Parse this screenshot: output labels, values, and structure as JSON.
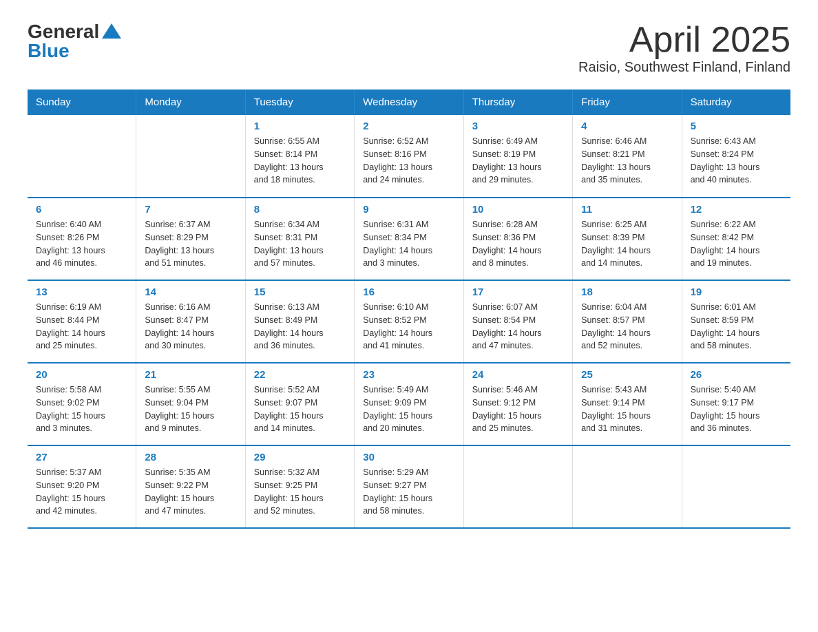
{
  "header": {
    "logo_general": "General",
    "logo_blue": "Blue",
    "month_title": "April 2025",
    "location": "Raisio, Southwest Finland, Finland"
  },
  "days_of_week": [
    "Sunday",
    "Monday",
    "Tuesday",
    "Wednesday",
    "Thursday",
    "Friday",
    "Saturday"
  ],
  "weeks": [
    [
      {
        "day": "",
        "info": ""
      },
      {
        "day": "",
        "info": ""
      },
      {
        "day": "1",
        "info": "Sunrise: 6:55 AM\nSunset: 8:14 PM\nDaylight: 13 hours\nand 18 minutes."
      },
      {
        "day": "2",
        "info": "Sunrise: 6:52 AM\nSunset: 8:16 PM\nDaylight: 13 hours\nand 24 minutes."
      },
      {
        "day": "3",
        "info": "Sunrise: 6:49 AM\nSunset: 8:19 PM\nDaylight: 13 hours\nand 29 minutes."
      },
      {
        "day": "4",
        "info": "Sunrise: 6:46 AM\nSunset: 8:21 PM\nDaylight: 13 hours\nand 35 minutes."
      },
      {
        "day": "5",
        "info": "Sunrise: 6:43 AM\nSunset: 8:24 PM\nDaylight: 13 hours\nand 40 minutes."
      }
    ],
    [
      {
        "day": "6",
        "info": "Sunrise: 6:40 AM\nSunset: 8:26 PM\nDaylight: 13 hours\nand 46 minutes."
      },
      {
        "day": "7",
        "info": "Sunrise: 6:37 AM\nSunset: 8:29 PM\nDaylight: 13 hours\nand 51 minutes."
      },
      {
        "day": "8",
        "info": "Sunrise: 6:34 AM\nSunset: 8:31 PM\nDaylight: 13 hours\nand 57 minutes."
      },
      {
        "day": "9",
        "info": "Sunrise: 6:31 AM\nSunset: 8:34 PM\nDaylight: 14 hours\nand 3 minutes."
      },
      {
        "day": "10",
        "info": "Sunrise: 6:28 AM\nSunset: 8:36 PM\nDaylight: 14 hours\nand 8 minutes."
      },
      {
        "day": "11",
        "info": "Sunrise: 6:25 AM\nSunset: 8:39 PM\nDaylight: 14 hours\nand 14 minutes."
      },
      {
        "day": "12",
        "info": "Sunrise: 6:22 AM\nSunset: 8:42 PM\nDaylight: 14 hours\nand 19 minutes."
      }
    ],
    [
      {
        "day": "13",
        "info": "Sunrise: 6:19 AM\nSunset: 8:44 PM\nDaylight: 14 hours\nand 25 minutes."
      },
      {
        "day": "14",
        "info": "Sunrise: 6:16 AM\nSunset: 8:47 PM\nDaylight: 14 hours\nand 30 minutes."
      },
      {
        "day": "15",
        "info": "Sunrise: 6:13 AM\nSunset: 8:49 PM\nDaylight: 14 hours\nand 36 minutes."
      },
      {
        "day": "16",
        "info": "Sunrise: 6:10 AM\nSunset: 8:52 PM\nDaylight: 14 hours\nand 41 minutes."
      },
      {
        "day": "17",
        "info": "Sunrise: 6:07 AM\nSunset: 8:54 PM\nDaylight: 14 hours\nand 47 minutes."
      },
      {
        "day": "18",
        "info": "Sunrise: 6:04 AM\nSunset: 8:57 PM\nDaylight: 14 hours\nand 52 minutes."
      },
      {
        "day": "19",
        "info": "Sunrise: 6:01 AM\nSunset: 8:59 PM\nDaylight: 14 hours\nand 58 minutes."
      }
    ],
    [
      {
        "day": "20",
        "info": "Sunrise: 5:58 AM\nSunset: 9:02 PM\nDaylight: 15 hours\nand 3 minutes."
      },
      {
        "day": "21",
        "info": "Sunrise: 5:55 AM\nSunset: 9:04 PM\nDaylight: 15 hours\nand 9 minutes."
      },
      {
        "day": "22",
        "info": "Sunrise: 5:52 AM\nSunset: 9:07 PM\nDaylight: 15 hours\nand 14 minutes."
      },
      {
        "day": "23",
        "info": "Sunrise: 5:49 AM\nSunset: 9:09 PM\nDaylight: 15 hours\nand 20 minutes."
      },
      {
        "day": "24",
        "info": "Sunrise: 5:46 AM\nSunset: 9:12 PM\nDaylight: 15 hours\nand 25 minutes."
      },
      {
        "day": "25",
        "info": "Sunrise: 5:43 AM\nSunset: 9:14 PM\nDaylight: 15 hours\nand 31 minutes."
      },
      {
        "day": "26",
        "info": "Sunrise: 5:40 AM\nSunset: 9:17 PM\nDaylight: 15 hours\nand 36 minutes."
      }
    ],
    [
      {
        "day": "27",
        "info": "Sunrise: 5:37 AM\nSunset: 9:20 PM\nDaylight: 15 hours\nand 42 minutes."
      },
      {
        "day": "28",
        "info": "Sunrise: 5:35 AM\nSunset: 9:22 PM\nDaylight: 15 hours\nand 47 minutes."
      },
      {
        "day": "29",
        "info": "Sunrise: 5:32 AM\nSunset: 9:25 PM\nDaylight: 15 hours\nand 52 minutes."
      },
      {
        "day": "30",
        "info": "Sunrise: 5:29 AM\nSunset: 9:27 PM\nDaylight: 15 hours\nand 58 minutes."
      },
      {
        "day": "",
        "info": ""
      },
      {
        "day": "",
        "info": ""
      },
      {
        "day": "",
        "info": ""
      }
    ]
  ]
}
